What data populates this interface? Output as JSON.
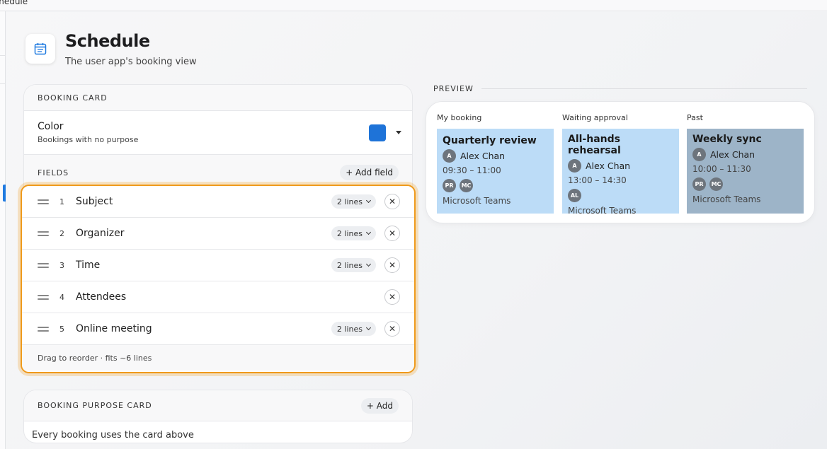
{
  "window": {
    "title": "Schedule"
  },
  "header": {
    "title": "Schedule",
    "subtitle": "The user app's booking view"
  },
  "booking_card": {
    "section_label": "BOOKING CARD",
    "color": {
      "label": "Color",
      "sub": "Bookings with no purpose",
      "value": "#1e73d8"
    },
    "fields_label": "FIELDS",
    "add_field_label": "+ Add field",
    "fields": [
      {
        "num": "1",
        "name": "Subject",
        "lines": "2 lines"
      },
      {
        "num": "2",
        "name": "Organizer",
        "lines": "2 lines"
      },
      {
        "num": "3",
        "name": "Time",
        "lines": "2 lines"
      },
      {
        "num": "4",
        "name": "Attendees",
        "lines": ""
      },
      {
        "num": "5",
        "name": "Online meeting",
        "lines": "2 lines"
      }
    ],
    "footer": "Drag to reorder · fits ~6 lines"
  },
  "purpose_card": {
    "section_label": "BOOKING PURPOSE CARD",
    "add_label": "+ Add",
    "body": "Every booking uses the card above"
  },
  "preview": {
    "label": "PREVIEW",
    "columns": [
      {
        "head": "My booking",
        "title": "Quarterly review",
        "org_initial": "A",
        "org": "Alex Chan",
        "time": "09:30 – 11:00",
        "attendees": [
          "PR",
          "MC"
        ],
        "meeting": "Microsoft Teams",
        "style": "mine"
      },
      {
        "head": "Waiting approval",
        "title": "All-hands rehearsal",
        "org_initial": "A",
        "org": "Alex Chan",
        "time": "13:00 – 14:30",
        "attendees": [
          "AL"
        ],
        "meeting": "Microsoft Teams",
        "style": "pending"
      },
      {
        "head": "Past",
        "title": "Weekly sync",
        "org_initial": "A",
        "org": "Alex Chan",
        "time": "10:00 – 11:30",
        "attendees": [
          "PR",
          "MC"
        ],
        "meeting": "Microsoft Teams",
        "style": "past"
      }
    ]
  },
  "colors": {
    "accent": "#1e73d8",
    "highlight": "#ef9a1b",
    "booking_bg": "#bcdcf7",
    "past_bg": "#9db4c8"
  }
}
